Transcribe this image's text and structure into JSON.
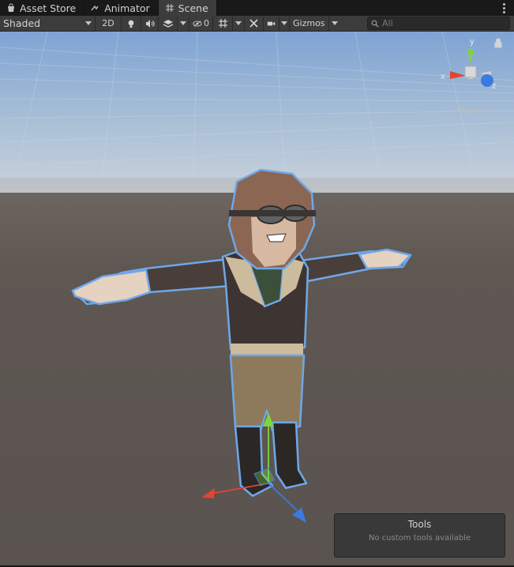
{
  "tabs": [
    {
      "label": "Asset Store",
      "icon": "bag-icon",
      "active": false
    },
    {
      "label": "Animator",
      "icon": "animator-icon",
      "active": false
    },
    {
      "label": "Scene",
      "icon": "grid-icon",
      "active": true
    }
  ],
  "toolbar": {
    "draw_mode": "Shaded",
    "mode_2d": "2D",
    "hidden_count": "0",
    "gizmos": "Gizmos"
  },
  "search": {
    "placeholder": "All"
  },
  "gizmo": {
    "x_label": "x",
    "y_label": "y",
    "z_label": "z",
    "projection": "Persp"
  },
  "tools_overlay": {
    "title": "Tools",
    "message": "No custom tools available"
  },
  "colors": {
    "x_axis": "#e0452f",
    "y_axis": "#7ed63a",
    "z_axis": "#3a7be0",
    "selection_outline": "#6fa7e8",
    "sky": "#8fb0d8",
    "ground": "#5c5550"
  }
}
